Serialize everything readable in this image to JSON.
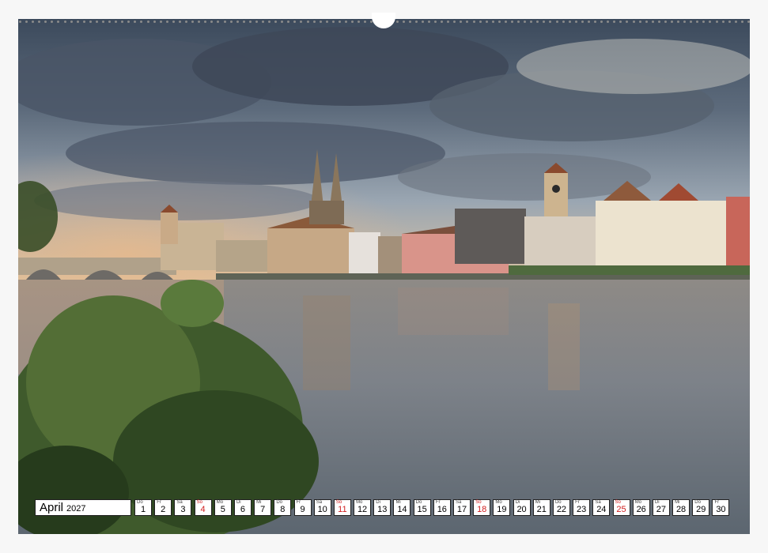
{
  "calendar": {
    "month": "April",
    "year": "2027",
    "colors": {
      "sunday": "#d01e1e",
      "weekday": "#000000"
    },
    "days": [
      {
        "wd": "Do",
        "num": "1",
        "sun": false
      },
      {
        "wd": "Fr",
        "num": "2",
        "sun": false
      },
      {
        "wd": "Sa",
        "num": "3",
        "sun": false
      },
      {
        "wd": "So",
        "num": "4",
        "sun": true
      },
      {
        "wd": "Mo",
        "num": "5",
        "sun": false
      },
      {
        "wd": "Di",
        "num": "6",
        "sun": false
      },
      {
        "wd": "Mi",
        "num": "7",
        "sun": false
      },
      {
        "wd": "Do",
        "num": "8",
        "sun": false
      },
      {
        "wd": "Fr",
        "num": "9",
        "sun": false
      },
      {
        "wd": "Sa",
        "num": "10",
        "sun": false
      },
      {
        "wd": "So",
        "num": "11",
        "sun": true
      },
      {
        "wd": "Mo",
        "num": "12",
        "sun": false
      },
      {
        "wd": "Di",
        "num": "13",
        "sun": false
      },
      {
        "wd": "Mi",
        "num": "14",
        "sun": false
      },
      {
        "wd": "Do",
        "num": "15",
        "sun": false
      },
      {
        "wd": "Fr",
        "num": "16",
        "sun": false
      },
      {
        "wd": "Sa",
        "num": "17",
        "sun": false
      },
      {
        "wd": "So",
        "num": "18",
        "sun": true
      },
      {
        "wd": "Mo",
        "num": "19",
        "sun": false
      },
      {
        "wd": "Di",
        "num": "20",
        "sun": false
      },
      {
        "wd": "Mi",
        "num": "21",
        "sun": false
      },
      {
        "wd": "Do",
        "num": "22",
        "sun": false
      },
      {
        "wd": "Fr",
        "num": "23",
        "sun": false
      },
      {
        "wd": "Sa",
        "num": "24",
        "sun": false
      },
      {
        "wd": "So",
        "num": "25",
        "sun": true
      },
      {
        "wd": "Mo",
        "num": "26",
        "sun": false
      },
      {
        "wd": "Di",
        "num": "27",
        "sun": false
      },
      {
        "wd": "Mi",
        "num": "28",
        "sun": false
      },
      {
        "wd": "Do",
        "num": "29",
        "sun": false
      },
      {
        "wd": "Fr",
        "num": "30",
        "sun": false
      }
    ]
  }
}
